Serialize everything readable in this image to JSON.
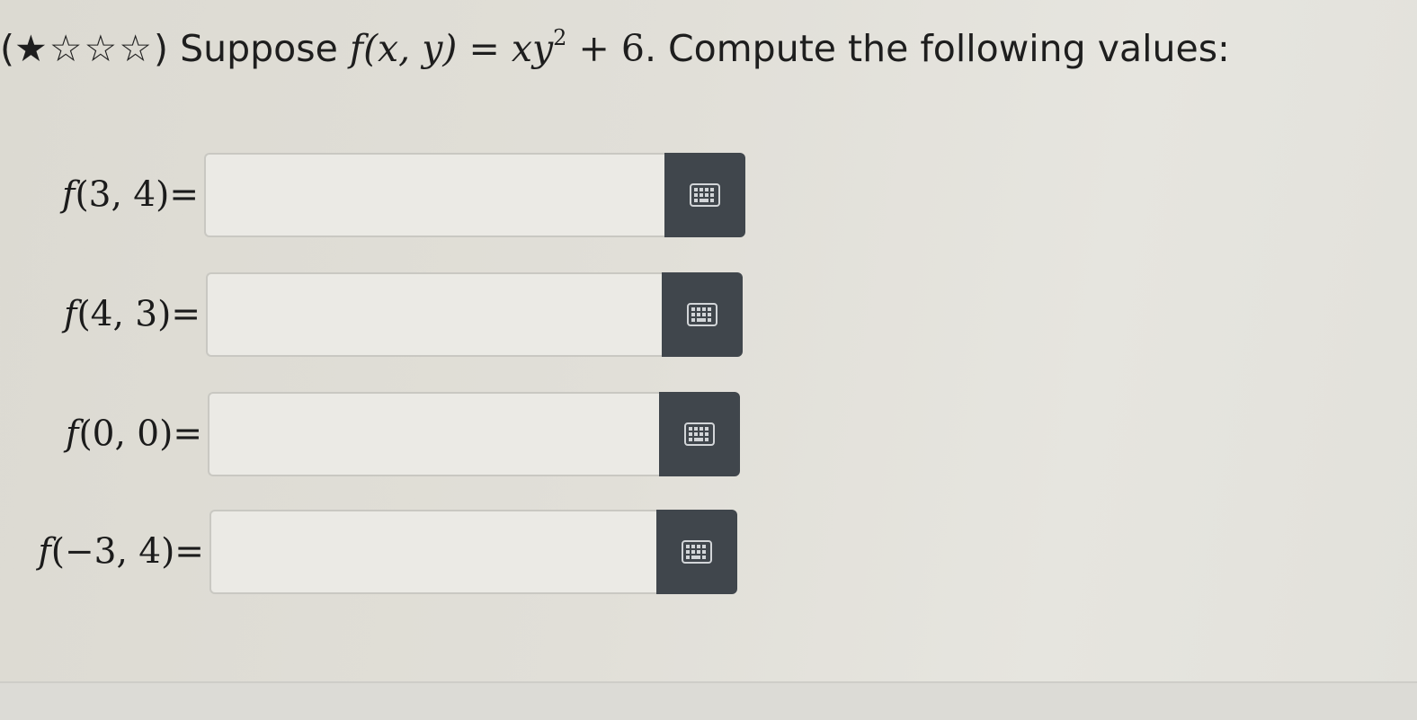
{
  "question": {
    "rating_filled": "★",
    "rating_empty": "☆☆☆",
    "intro": "Suppose",
    "function_name": "f",
    "function_args": "(x, y)",
    "equals": "=",
    "expr_base": "xy",
    "expr_exponent": "2",
    "expr_tail": "+ 6",
    "outro": ". Compute the following values:"
  },
  "inputs": [
    {
      "fn": "f",
      "args": "(3, 4)=",
      "value": ""
    },
    {
      "fn": "f",
      "args": "(4, 3)=",
      "value": ""
    },
    {
      "fn": "f",
      "args": "(0, 0)=",
      "value": ""
    },
    {
      "fn": "f",
      "args": "(−3, 4)=",
      "value": ""
    }
  ],
  "keyboard_button_icon": "keypad-icon",
  "colors": {
    "background": "#e1dfd8",
    "field_background": "#ebeae5",
    "field_border": "#c9c8c2",
    "keyboard_button": "#40464c",
    "keyboard_icon": "#d2d5d8"
  }
}
